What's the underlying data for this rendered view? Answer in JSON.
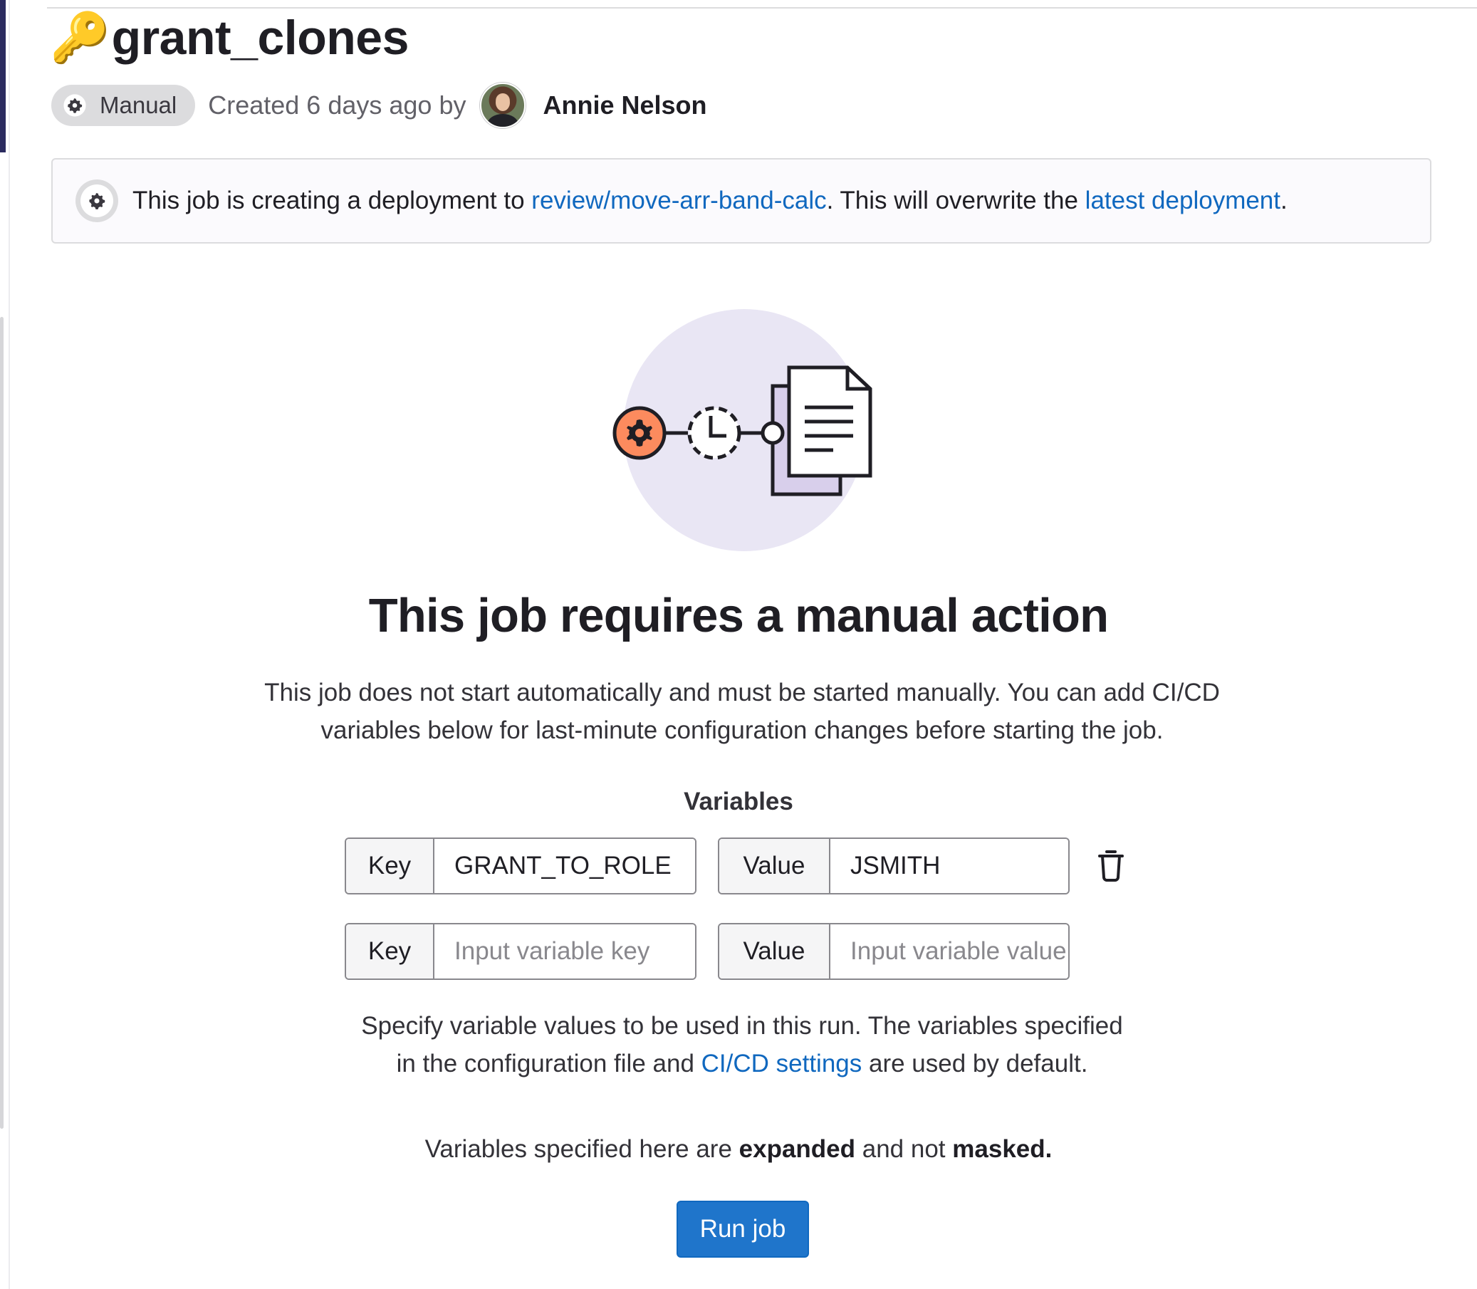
{
  "job": {
    "key_emoji": "🔑",
    "name": "grant_clones"
  },
  "meta": {
    "status_badge": "Manual",
    "created_text": "Created 6 days ago by",
    "author_name": "Annie Nelson"
  },
  "deployment_alert": {
    "prefix": "This job is creating a deployment to ",
    "environment_link": "review/move-arr-band-calc",
    "middle": ". This will overwrite the ",
    "latest_link": "latest deployment",
    "suffix": "."
  },
  "empty_state": {
    "title": "This job requires a manual action",
    "description": "This job does not start automatically and must be started manually. You can add CI/CD variables below for last-minute configuration changes before starting the job."
  },
  "variables": {
    "section_label": "Variables",
    "key_prefix": "Key",
    "value_prefix": "Value",
    "rows": [
      {
        "key": "GRANT_TO_ROLE",
        "value": "JSMITH"
      },
      {
        "key": "",
        "value": ""
      }
    ],
    "key_placeholder": "Input variable key",
    "value_placeholder": "Input variable value"
  },
  "help": {
    "part1": "Specify variable values to be used in this run. The variables specified in the configuration file and ",
    "settings_link": "CI/CD settings",
    "part2": " are used by default.",
    "line2_prefix": "Variables specified here are ",
    "expanded": "expanded",
    "line2_middle": " and not ",
    "masked": "masked."
  },
  "actions": {
    "run_job": "Run job"
  },
  "colors": {
    "link": "#1068bf",
    "primary_button": "#1f75cb",
    "illustration_circle": "#e9e6f4",
    "illustration_accent": "#fc8b5e",
    "illustration_doc_back": "#d8cfeb"
  }
}
